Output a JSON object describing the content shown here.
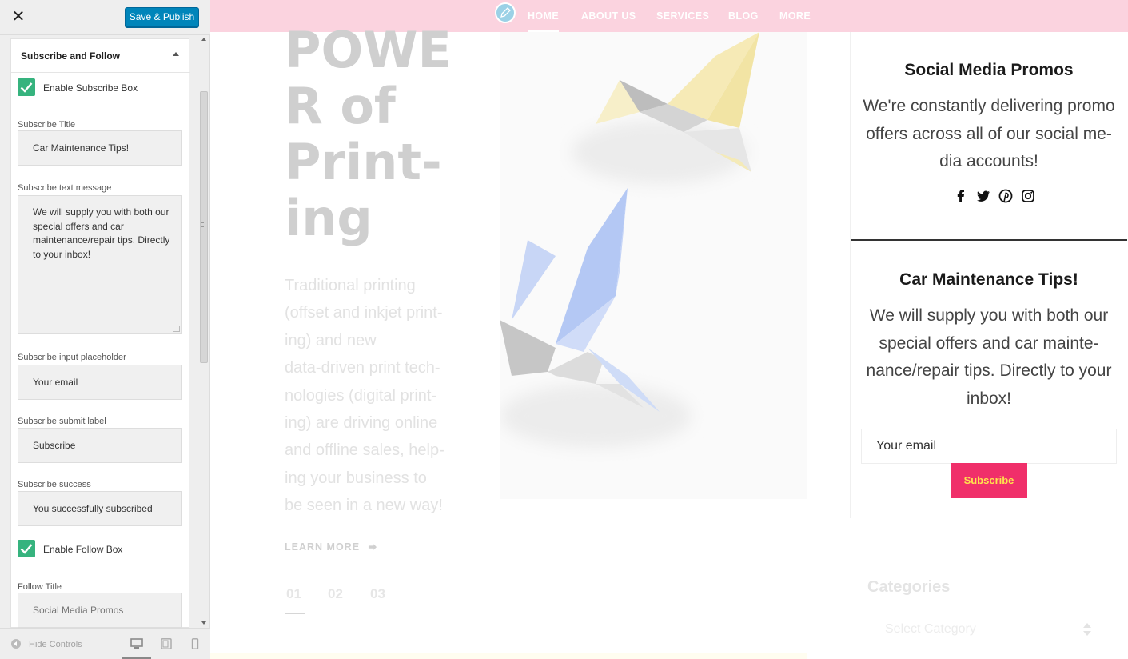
{
  "customizer": {
    "close_icon": "close-icon",
    "save_label": "Save & Publish",
    "colors": {
      "primary": "#0085ba",
      "checkbox": "#36b37e"
    },
    "section": {
      "title": "Subscribe and Follow",
      "enable_subscribe_label": "Enable Subscribe Box",
      "enable_subscribe_checked": true,
      "fields": {
        "subscribe_title": {
          "label": "Subscribe Title",
          "value": "Car Maintenance Tips!"
        },
        "subscribe_text": {
          "label": "Subscribe text message",
          "value": "We will supply you with both our special offers and car maintenance/repair tips. Directly to your inbox!"
        },
        "subscribe_placeholder": {
          "label": "Subscribe input placeholder",
          "value": "Your email"
        },
        "subscribe_submit": {
          "label": "Subscribe submit label",
          "value": "Subscribe"
        },
        "subscribe_success": {
          "label": "Subscribe success",
          "value": "You successfully subscribed"
        },
        "follow_title": {
          "label": "Follow Title",
          "value": "Social Media Promos"
        }
      },
      "enable_follow_label": "Enable Follow Box",
      "enable_follow_checked": true
    },
    "footer": {
      "hide_controls_label": "Hide Controls",
      "devices": [
        "desktop-icon",
        "tablet-icon",
        "mobile-icon"
      ],
      "active_device": "desktop"
    }
  },
  "preview": {
    "nav": {
      "items": [
        "HOME",
        "ABOUT US",
        "SERVICES",
        "BLOG",
        "MORE"
      ],
      "active": "HOME",
      "background": "#fbd3df"
    },
    "hero": {
      "title_lines": [
        "POWE",
        "R of",
        "Print-",
        "ing"
      ],
      "text": "Traditional printing (offset and inkjet printing) and new data-driven print technologies (digital printing) are driving online and offline sales, helping your business to be seen in a new way!",
      "text_lines": [
        "Traditional printing",
        "(offset and inkjet print-",
        "ing) and new",
        "data-driven print tech-",
        "nologies (digital print-",
        "ing) are driving online",
        "and offline sales, help-",
        "ing your business to",
        "be seen in a new way!"
      ],
      "learn_more": "LEARN MORE",
      "slides": [
        "01",
        "02",
        "03"
      ],
      "active_slide": "01"
    },
    "follow_widget": {
      "title": "Social Media Promos",
      "text_lines": [
        "We're constantly delivering promo",
        "offers across all of our social me-",
        "dia accounts!"
      ],
      "socials": [
        "facebook-icon",
        "twitter-icon",
        "pinterest-icon",
        "instagram-icon"
      ]
    },
    "subscribe_widget": {
      "title": "Car Maintenance Tips!",
      "text_lines": [
        "We will supply you with both our",
        "special offers and car mainte-",
        "nance/repair tips. Directly to your",
        "inbox!"
      ],
      "input_placeholder": "Your email",
      "button_label": "Subscribe",
      "button_color": "#f02f6a",
      "button_text_color": "#ffe34d"
    },
    "categories": {
      "title": "Categories",
      "select_value": "Select Category"
    }
  }
}
